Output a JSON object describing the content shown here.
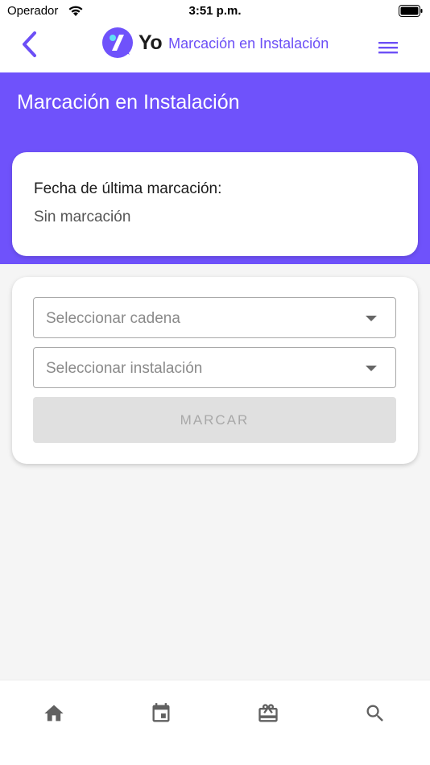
{
  "status_bar": {
    "carrier": "Operador",
    "time": "3:51 p.m."
  },
  "header": {
    "brand": "Yo",
    "title": "Marcación en Instalación"
  },
  "hero": {
    "title": "Marcación en Instalación",
    "last_mark_label": "Fecha de última marcación:",
    "last_mark_value": "Sin marcación"
  },
  "form": {
    "chain_placeholder": "Seleccionar cadena",
    "installation_placeholder": "Seleccionar instalación",
    "submit_label": "MARCAR"
  },
  "bottom_nav": {
    "items": [
      "home-icon",
      "calendar-icon",
      "gift-icon",
      "search-icon"
    ]
  },
  "colors": {
    "accent": "#6f52fb",
    "header_title": "#6c4ff6",
    "disabled_button": "#e0e0e0"
  }
}
